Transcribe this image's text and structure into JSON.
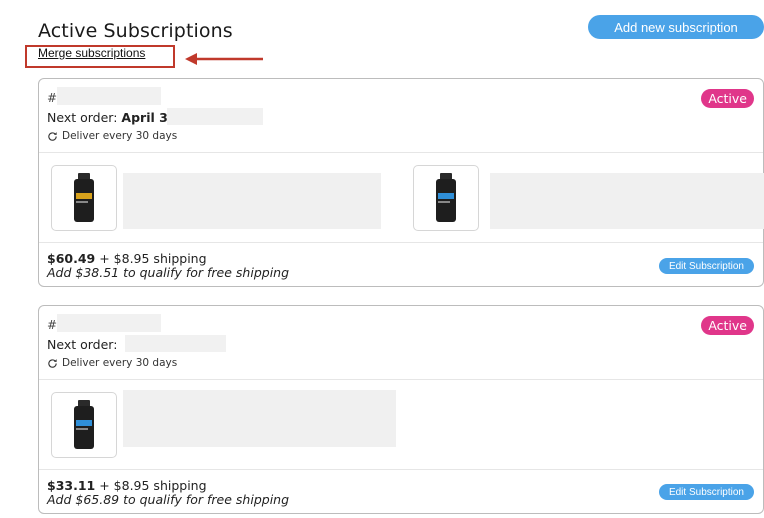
{
  "header": {
    "title": "Active Subscriptions",
    "add_button": "Add new subscription",
    "merge_link": "Merge subscriptions"
  },
  "colors": {
    "accent_blue": "#4aa3e8",
    "active_badge": "#e0368a",
    "highlight_red": "#c0392b"
  },
  "subscriptions": [
    {
      "id_prefix": "#",
      "status": "Active",
      "next_order_label": "Next order:",
      "next_order_value": "April 3",
      "deliver_text": "Deliver every 30 days",
      "price": "$60.49",
      "shipping": " + $8.95 shipping",
      "free_shipping_note": "Add $38.51 to qualify for free shipping",
      "edit_button": "Edit Subscription",
      "products": [
        "bottle-icon",
        "bottle-icon"
      ]
    },
    {
      "id_prefix": "#",
      "status": "Active",
      "next_order_label": "Next order:",
      "next_order_value": "",
      "deliver_text": "Deliver every 30 days",
      "price": "$33.11",
      "shipping": " + $8.95 shipping",
      "free_shipping_note": "Add $65.89 to qualify for free shipping",
      "edit_button": "Edit Subscription",
      "products": [
        "bottle-icon"
      ]
    }
  ]
}
